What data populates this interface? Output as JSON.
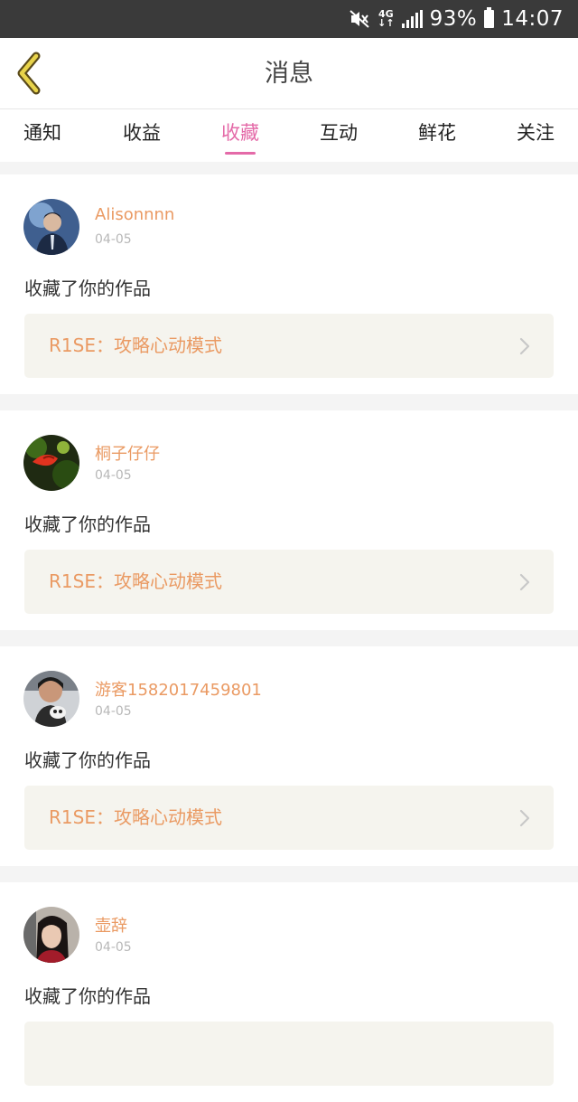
{
  "status_bar": {
    "battery": "93%",
    "time": "14:07",
    "network": "4G"
  },
  "header": {
    "title": "消息"
  },
  "tabs": [
    {
      "label": "通知"
    },
    {
      "label": "收益"
    },
    {
      "label": "收藏"
    },
    {
      "label": "互动"
    },
    {
      "label": "鲜花"
    },
    {
      "label": "关注"
    }
  ],
  "active_tab": "收藏",
  "colors": {
    "accent": "#e46aa8",
    "username": "#ea9a63",
    "link_bg": "#f5f4ee"
  },
  "messages": [
    {
      "username": "Alisonnnn",
      "date": "04-05",
      "action": "收藏了你的作品",
      "work_title": "R1SE：攻略心动模式"
    },
    {
      "username": "桐子仔仔",
      "date": "04-05",
      "action": "收藏了你的作品",
      "work_title": "R1SE：攻略心动模式"
    },
    {
      "username": "游客1582017459801",
      "date": "04-05",
      "action": "收藏了你的作品",
      "work_title": "R1SE：攻略心动模式"
    },
    {
      "username": "壶辞",
      "date": "04-05",
      "action": "收藏了你的作品",
      "work_title": ""
    }
  ]
}
